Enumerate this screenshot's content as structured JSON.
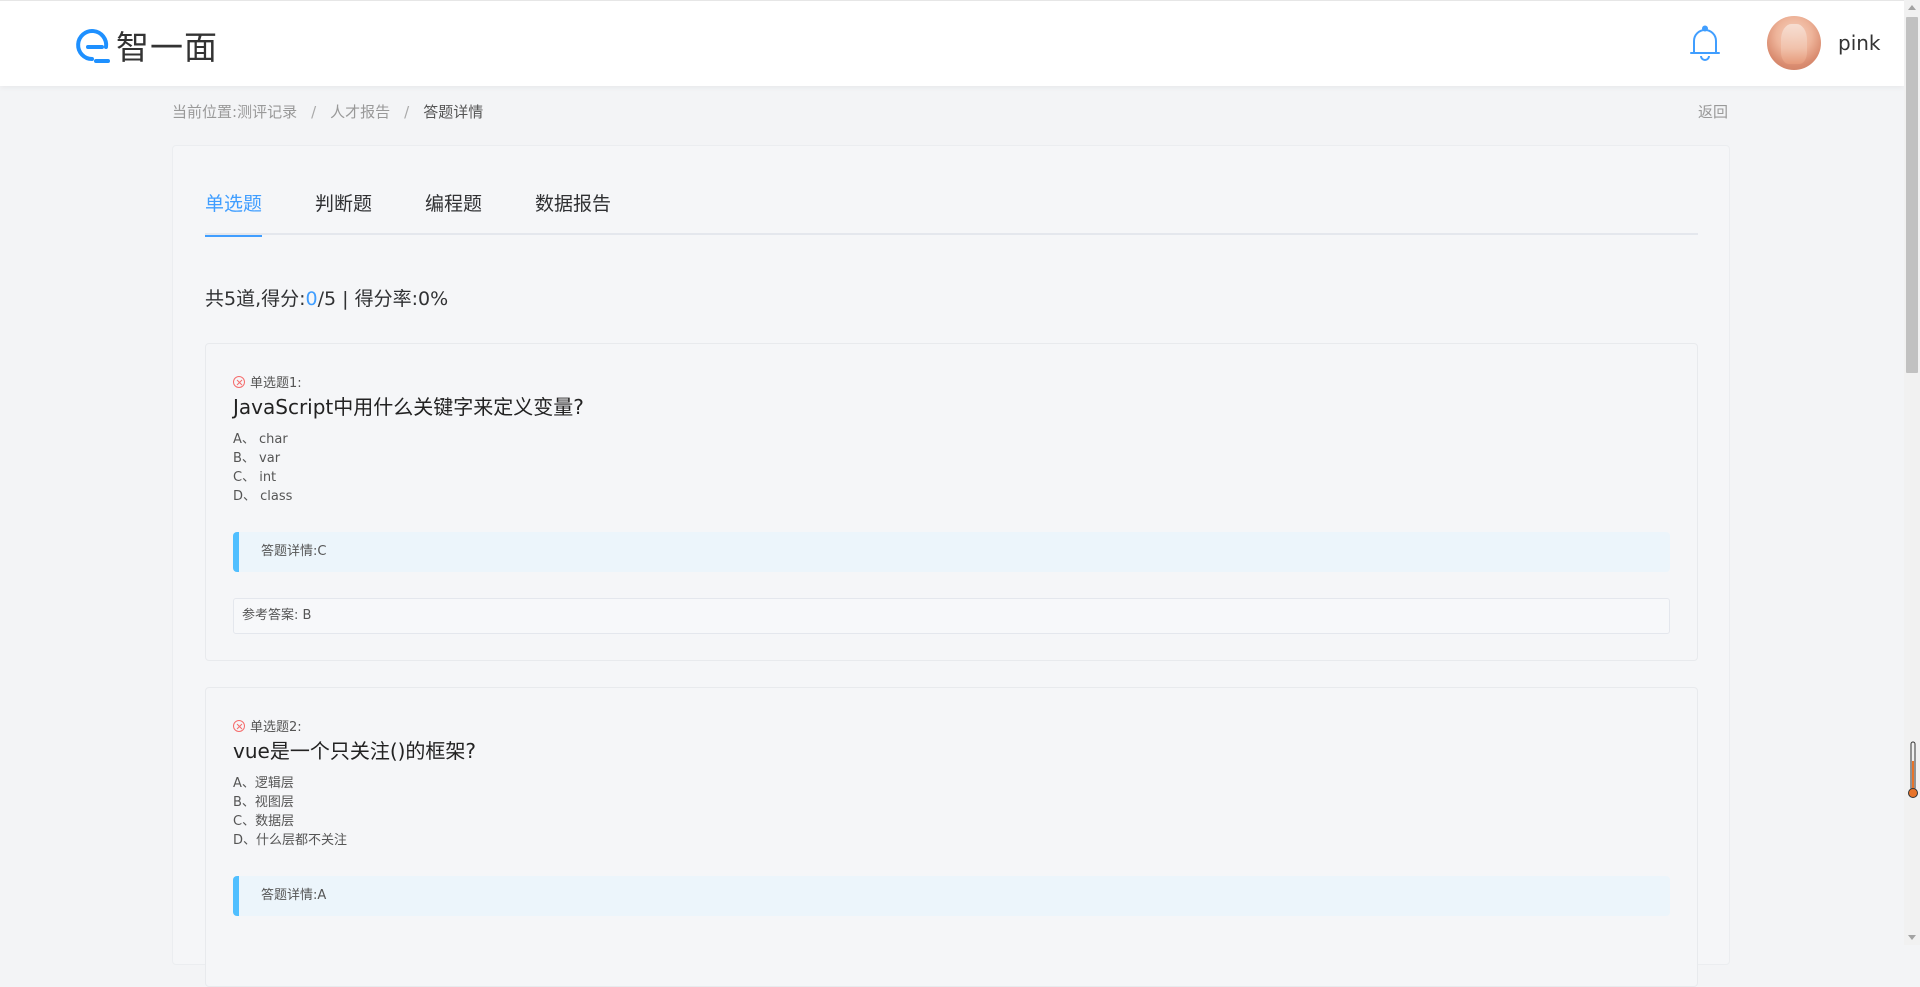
{
  "header": {
    "logo_text": "智一面",
    "username": "pink"
  },
  "breadcrumb": {
    "prefix": "当前位置:",
    "items": [
      "测评记录",
      "人才报告",
      "答题详情"
    ],
    "separator": "/",
    "back": "返回"
  },
  "tabs": [
    {
      "label": "单选题",
      "active": true
    },
    {
      "label": "判断题",
      "active": false
    },
    {
      "label": "编程题",
      "active": false
    },
    {
      "label": "数据报告",
      "active": false
    }
  ],
  "summary": {
    "prefix": "共5道,得分:",
    "score": "0",
    "total": "/5 | 得分率:0%"
  },
  "questions": [
    {
      "label": "单选题1:",
      "title": "JavaScript中用什么关键字来定义变量?",
      "options": [
        "A、 char",
        "B、 var",
        "C、 int",
        "D、 class"
      ],
      "answer_detail": "答题详情:C",
      "reference": "参考答案: B"
    },
    {
      "label": "单选题2:",
      "title": "vue是一个只关注()的框架?",
      "options": [
        "A、逻辑层",
        "B、视图层",
        "C、数据层",
        "D、什么层都不关注"
      ],
      "answer_detail": "答题详情:A"
    }
  ],
  "colors": {
    "accent": "#409eff",
    "wrong": "#f56c6c",
    "answer_bar": "#50bfff"
  }
}
